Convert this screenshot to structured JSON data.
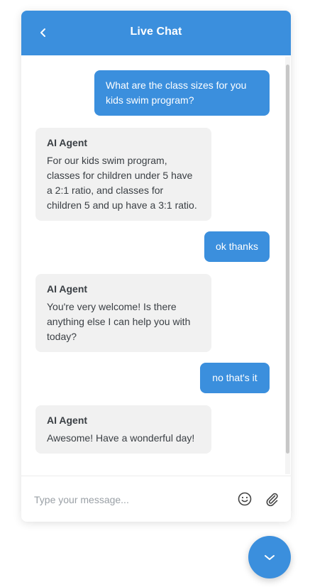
{
  "header": {
    "title": "Live Chat",
    "back_icon": "chevron-left-icon",
    "background_color": "#3b8fdd"
  },
  "messages": [
    {
      "sender": "user",
      "text": "What are the class sizes for you kids swim program?"
    },
    {
      "sender": "agent",
      "name": "AI Agent",
      "text": "For our kids swim program, classes for children under 5 have a 2:1 ratio, and classes for children 5 and up have a 3:1 ratio."
    },
    {
      "sender": "user",
      "text": "ok thanks"
    },
    {
      "sender": "agent",
      "name": "AI Agent",
      "text": "You're very welcome! Is there anything else I can help you with today?"
    },
    {
      "sender": "user",
      "text": "no that's it"
    },
    {
      "sender": "agent",
      "name": "AI Agent",
      "text": "Awesome! Have a wonderful day!"
    }
  ],
  "composer": {
    "placeholder": "Type your message...",
    "value": "",
    "emoji_icon": "smiley-icon",
    "attach_icon": "paperclip-icon"
  },
  "fab": {
    "icon": "chevron-down-icon"
  },
  "colors": {
    "accent": "#3b8fdd",
    "agent_bubble": "#f1f1f1",
    "agent_text": "#3a3f44"
  }
}
